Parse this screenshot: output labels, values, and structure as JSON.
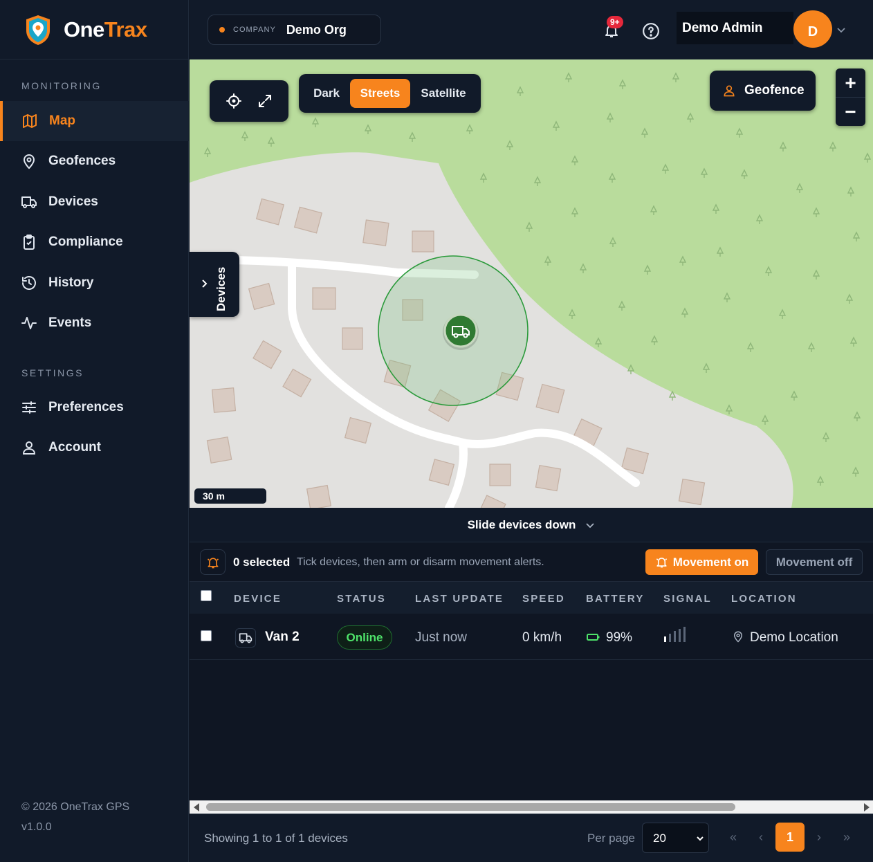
{
  "brand": {
    "name_part1": "One",
    "name_part2": "Trax"
  },
  "sidebar": {
    "monitoring_title": "MONITORING",
    "settings_title": "SETTINGS",
    "items": [
      {
        "label": "Map",
        "icon": "map-icon",
        "active": true
      },
      {
        "label": "Geofences",
        "icon": "map-pin-icon"
      },
      {
        "label": "Devices",
        "icon": "truck-icon"
      },
      {
        "label": "Compliance",
        "icon": "clipboard-check-icon"
      },
      {
        "label": "History",
        "icon": "history-icon"
      },
      {
        "label": "Events",
        "icon": "activity-icon"
      },
      {
        "label": "Preferences",
        "icon": "sliders-icon"
      },
      {
        "label": "Account",
        "icon": "user-icon"
      }
    ],
    "copyright": "© 2026 OneTrax GPS",
    "version": "v1.0.0"
  },
  "header": {
    "company_label": "COMPANY",
    "company_value": "Demo Org",
    "notification_badge": "9+",
    "user_name": "Demo Admin",
    "avatar_initial": "D"
  },
  "map": {
    "layers": [
      "Dark",
      "Streets",
      "Satellite"
    ],
    "active_layer": "Streets",
    "geofence_label": "Geofence",
    "zoom_in": "+",
    "zoom_out": "−",
    "devices_tab_label": "Devices",
    "scale_label": "30 m"
  },
  "slide_label": "Slide devices down",
  "actions": {
    "selected_count": "0 selected",
    "hint": "Tick devices, then arm or disarm movement alerts.",
    "movement_on": "Movement on",
    "movement_off": "Movement off"
  },
  "table": {
    "columns": [
      "DEVICE",
      "STATUS",
      "LAST UPDATE",
      "SPEED",
      "BATTERY",
      "SIGNAL",
      "LOCATION"
    ],
    "rows": [
      {
        "device": "Van 2",
        "status": "Online",
        "last_update": "Just now",
        "speed": "0 km/h",
        "battery": "99%",
        "signal_bars": 1,
        "location": "Demo Location"
      }
    ]
  },
  "pagination": {
    "showing": "Showing 1 to 1 of 1 devices",
    "per_page_label": "Per page",
    "per_page_value": "20",
    "first": "«",
    "prev": "‹",
    "current_page": "1",
    "next": "›",
    "last": "»"
  },
  "colors": {
    "accent": "#f7841d",
    "online": "#4ee36a",
    "sidebar_bg": "#111a29",
    "page_bg": "#0f1623"
  }
}
